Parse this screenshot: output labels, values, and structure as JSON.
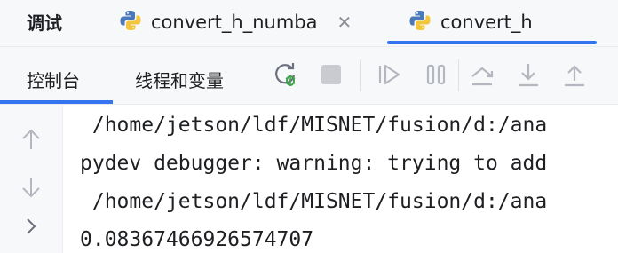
{
  "debug_panel": {
    "title": "调试"
  },
  "run_tabs": [
    {
      "label": "convert_h_numba",
      "icon": "python-icon",
      "close": "✕"
    },
    {
      "label": "convert_h",
      "icon": "python-icon",
      "close": "✕"
    }
  ],
  "subtabs": {
    "console": "控制台",
    "variables": "线程和变量"
  },
  "toolbar": {
    "icons": [
      "rerun-debug-icon",
      "stop-icon",
      "resume-icon",
      "pause-icon",
      "step-over-icon",
      "step-into-icon",
      "step-out-icon"
    ]
  },
  "gutter": {
    "icons": [
      "arrow-up-icon",
      "arrow-down-icon",
      "chevron-right-icon"
    ]
  },
  "console": {
    "lines": [
      " /home/jetson/ldf/MISNET/fusion/d:/ana",
      "pydev debugger: warning: trying to add",
      " /home/jetson/ldf/MISNET/fusion/d:/ana",
      "0.08367466926574707"
    ]
  },
  "colors": {
    "accent": "#3574f0",
    "python_blue": "#4a78b8",
    "python_yellow": "#f2c53d",
    "debug_green": "#3da34a"
  }
}
